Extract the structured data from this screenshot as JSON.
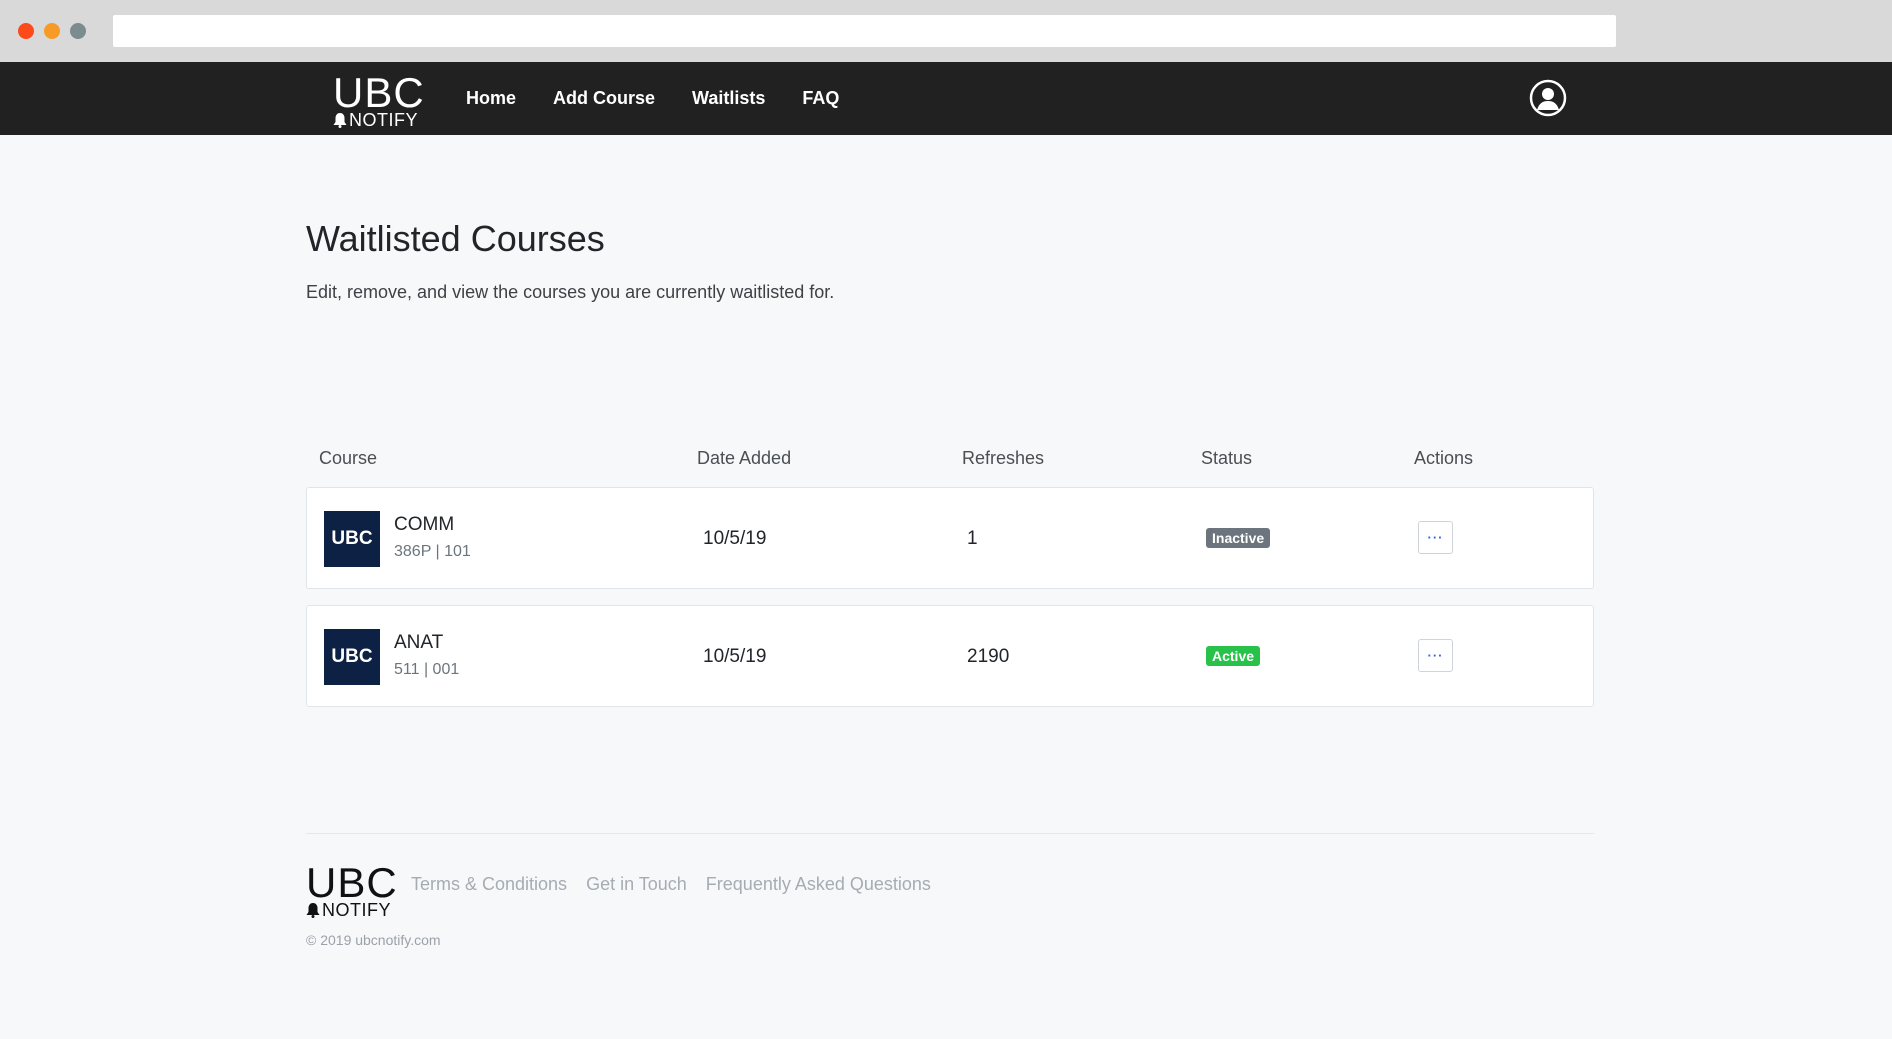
{
  "navbar": {
    "logo": {
      "title": "UBC",
      "subtitle": "NOTIFY"
    },
    "links": [
      "Home",
      "Add Course",
      "Waitlists",
      "FAQ"
    ],
    "profile_icon": "user-circle-icon"
  },
  "page": {
    "title": "Waitlisted Courses",
    "subtitle": "Edit, remove, and view the courses you are currently waitlisted for."
  },
  "table": {
    "headers": [
      "Course",
      "Date Added",
      "Refreshes",
      "Status",
      "Actions"
    ],
    "rows": [
      {
        "badge": "UBC",
        "course": "COMM",
        "section": "386P | 101",
        "date_added": "10/5/19",
        "refreshes": "1",
        "status": "Inactive",
        "status_color": "#6c757d",
        "action": "···"
      },
      {
        "badge": "UBC",
        "course": "ANAT",
        "section": "511 | 001",
        "date_added": "10/5/19",
        "refreshes": "2190",
        "status": "Active",
        "status_color": "#28c24a",
        "action": "···"
      }
    ]
  },
  "footer": {
    "logo": {
      "title": "UBC",
      "subtitle": "NOTIFY"
    },
    "links": [
      "Terms & Conditions",
      "Get in Touch",
      "Frequently Asked Questions"
    ],
    "copyright": "© 2019 ubcnotify.com"
  },
  "colors": {
    "navbar_bg": "#212121",
    "badge_bg": "#0c2144",
    "page_bg": "#f7f8fa"
  }
}
